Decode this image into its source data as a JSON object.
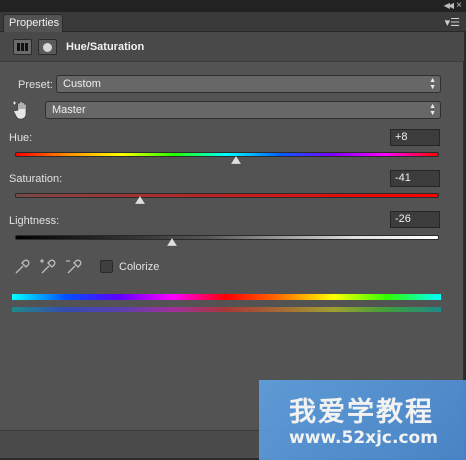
{
  "panel": {
    "tab_label": "Properties",
    "title": "Hue/Saturation"
  },
  "preset": {
    "label": "Preset:",
    "value": "Custom"
  },
  "channel": {
    "value": "Master"
  },
  "hue": {
    "label": "Hue:",
    "value": "+8",
    "min": -180,
    "max": 180
  },
  "saturation": {
    "label": "Saturation:",
    "value": "-41",
    "min": -100,
    "max": 100
  },
  "lightness": {
    "label": "Lightness:",
    "value": "-26",
    "min": -100,
    "max": 100
  },
  "colorize": {
    "label": "Colorize",
    "checked": false
  },
  "watermark": {
    "text": "我爱学教程",
    "url": "www.52xjc.com"
  },
  "icons": [
    "adjustment-layer-icon",
    "layer-mask-icon",
    "targeted-adjustment-hand-icon",
    "eyedropper-icon",
    "add-to-sample-eyedropper-icon",
    "subtract-from-sample-eyedropper-icon",
    "panel-menu-icon",
    "collapse-icon",
    "close-icon"
  ]
}
